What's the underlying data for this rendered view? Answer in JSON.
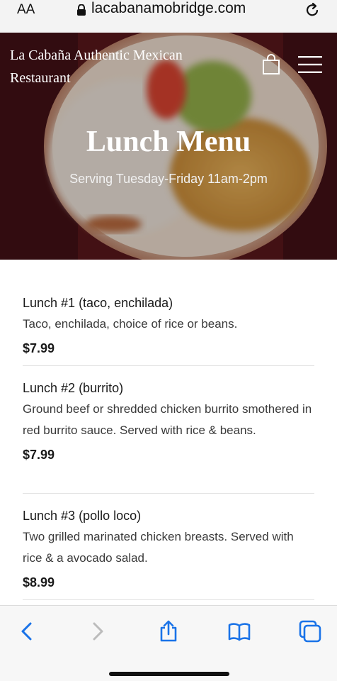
{
  "browser": {
    "aa_label": "AA",
    "url": "lacabanamobridge.com"
  },
  "hero": {
    "site_title": "La Cabaña Authentic Mexican Restaurant",
    "title": "Lunch Menu",
    "subtitle": "Serving Tuesday-Friday 11am-2pm"
  },
  "menu": {
    "items": [
      {
        "name": "Lunch #1 (taco, enchilada)",
        "description": "Taco, enchilada, choice of rice or beans.",
        "price": "$7.99"
      },
      {
        "name": "Lunch #2 (burrito)",
        "description": "Ground beef or shredded chicken burrito smothered in red burrito sauce. Served with rice & beans.",
        "price": "$7.99"
      },
      {
        "name": "Lunch #3 (pollo loco)",
        "description": "Two grilled marinated chicken breasts. Served with rice & a avocado salad.",
        "price": "$8.99"
      }
    ]
  },
  "colors": {
    "accent_blue": "#1a73e8",
    "hero_overlay": "#3a1010"
  },
  "icons": [
    "lock-icon",
    "reload-icon",
    "cart-icon",
    "menu-icon",
    "back-icon",
    "forward-icon",
    "share-icon",
    "bookmarks-icon",
    "tabs-icon"
  ]
}
